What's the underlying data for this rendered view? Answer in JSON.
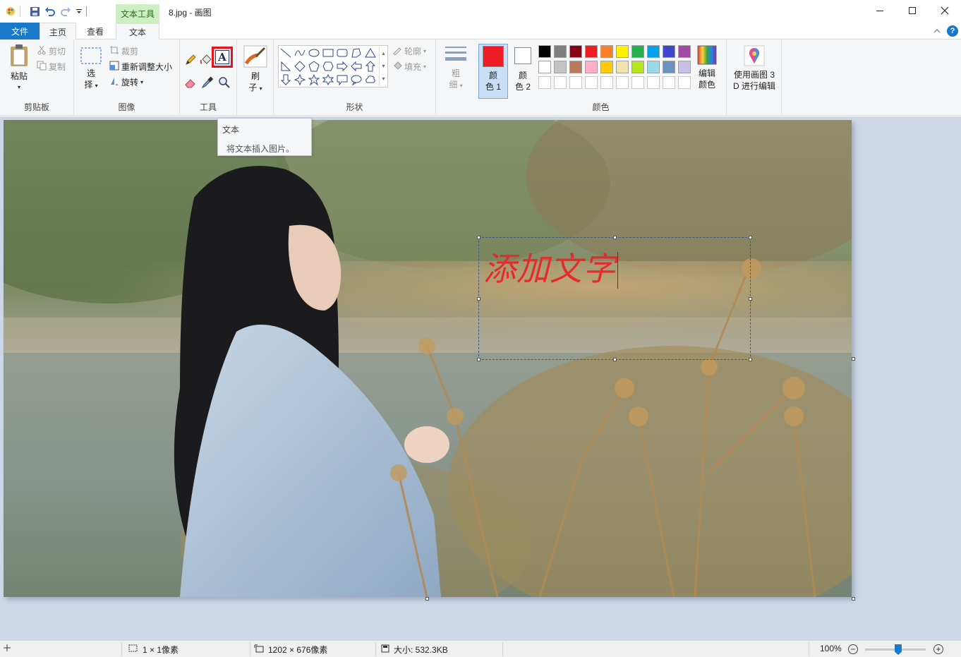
{
  "window": {
    "title": "8.jpg - 画图",
    "context_tab_group": "文本工具",
    "minimize_icon": "minimize-icon",
    "maximize_icon": "maximize-icon",
    "close_icon": "close-icon"
  },
  "tabs": {
    "file": "文件",
    "home": "主页",
    "view": "查看",
    "text": "文本"
  },
  "ribbon": {
    "clipboard": {
      "label": "剪贴板",
      "paste": "粘贴",
      "cut": "剪切",
      "copy": "复制"
    },
    "image": {
      "label": "图像",
      "select_top": "选",
      "select_bottom": "择",
      "crop": "裁剪",
      "resize": "重新调整大小",
      "rotate": "旋转"
    },
    "tools": {
      "label": "工具"
    },
    "brushes": {
      "label_top": "刷",
      "label_bottom": "子"
    },
    "shapes": {
      "label": "形状",
      "outline": "轮廓",
      "fill": "填充"
    },
    "size": {
      "label_top": "粗",
      "label_bottom": "细"
    },
    "colors": {
      "label": "颜色",
      "color1_top": "颜",
      "color1_bottom": "色 1",
      "color2_top": "颜",
      "color2_bottom": "色 2",
      "edit_top": "编辑",
      "edit_bottom": "颜色",
      "color1": "#ed1c24",
      "color2": "#ffffff",
      "palette_row1": [
        "#000000",
        "#7f7f7f",
        "#880015",
        "#ed1c24",
        "#ff7f27",
        "#fff200",
        "#22b14c",
        "#00a2e8",
        "#3f48cc",
        "#a349a4"
      ],
      "palette_row2": [
        "#ffffff",
        "#c3c3c3",
        "#b97a57",
        "#ffaec9",
        "#ffc90e",
        "#efe4b0",
        "#b5e61d",
        "#99d9ea",
        "#7092be",
        "#c8bfe7"
      ],
      "palette_row3": [
        "#ffffff",
        "#ffffff",
        "#ffffff",
        "#ffffff",
        "#ffffff",
        "#ffffff",
        "#ffffff",
        "#ffffff",
        "#ffffff",
        "#ffffff"
      ]
    },
    "paint3d": {
      "line1": "使用画图 3",
      "line2": "D 进行编辑"
    }
  },
  "tooltip": {
    "title": "文本",
    "description": "将文本插入图片。"
  },
  "canvas": {
    "text_content": "添加文字"
  },
  "statusbar": {
    "selection_size": "1 × 1像素",
    "image_size": "1202 × 676像素",
    "file_size": "大小: 532.3KB",
    "zoom": "100%",
    "zoom_level": 0.5
  }
}
